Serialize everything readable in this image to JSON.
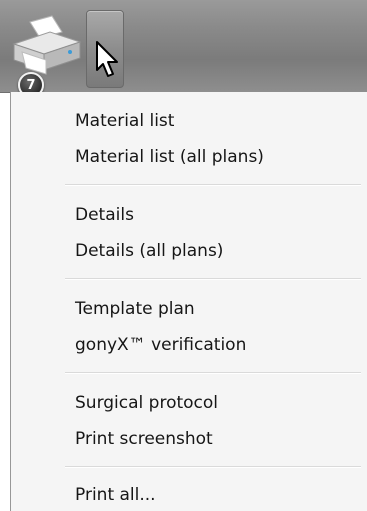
{
  "toolbar": {
    "print_badge": "7"
  },
  "menu": {
    "items": [
      {
        "label": "Material list"
      },
      {
        "label": "Material list (all plans)"
      },
      {
        "label": "Details"
      },
      {
        "label": "Details (all plans)"
      },
      {
        "label": "Template plan"
      },
      {
        "label": "gonyX™ verification"
      },
      {
        "label": "Surgical protocol"
      },
      {
        "label": "Print screenshot"
      },
      {
        "label": "Print all..."
      }
    ]
  },
  "icons": {
    "print": "printer-icon",
    "dropdown": "dropdown-arrow-button",
    "cursor": "mouse-cursor-icon"
  },
  "colors": {
    "toolbar_bg": "#8a8a8a",
    "menu_bg": "#f5f5f5",
    "text": "#161616",
    "separator": "#dadada"
  }
}
